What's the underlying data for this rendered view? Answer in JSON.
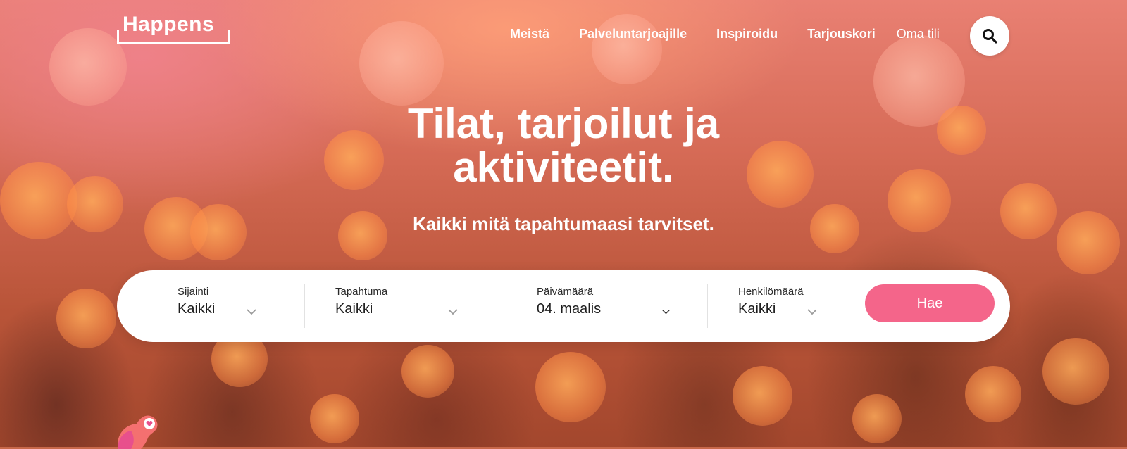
{
  "brand": {
    "logo_text": "Happens"
  },
  "nav": {
    "items": [
      {
        "label": "Meistä"
      },
      {
        "label": "Palveluntarjoajille"
      },
      {
        "label": "Inspiroidu"
      },
      {
        "label": "Tarjouskori"
      },
      {
        "label": "Oma tili"
      }
    ],
    "search_icon": "search-icon"
  },
  "hero": {
    "headline_line1": "Tilat, tarjoilut ja",
    "headline_line2": "aktiviteetit.",
    "subheadline": "Kaikki mitä tapahtumaasi tarvitset."
  },
  "search_form": {
    "location": {
      "label": "Sijainti",
      "value": "Kaikki"
    },
    "event": {
      "label": "Tapahtuma",
      "value": "Kaikki"
    },
    "date": {
      "label": "Päivämäärä",
      "value": "04. maalis"
    },
    "people": {
      "label": "Henkilömäärä",
      "value": "Kaikki"
    },
    "submit_label": "Hae"
  },
  "colors": {
    "accent": "#f4658a",
    "hero_top": "#e98073",
    "hero_bottom": "#a3472d",
    "text_light": "#ffffff"
  }
}
